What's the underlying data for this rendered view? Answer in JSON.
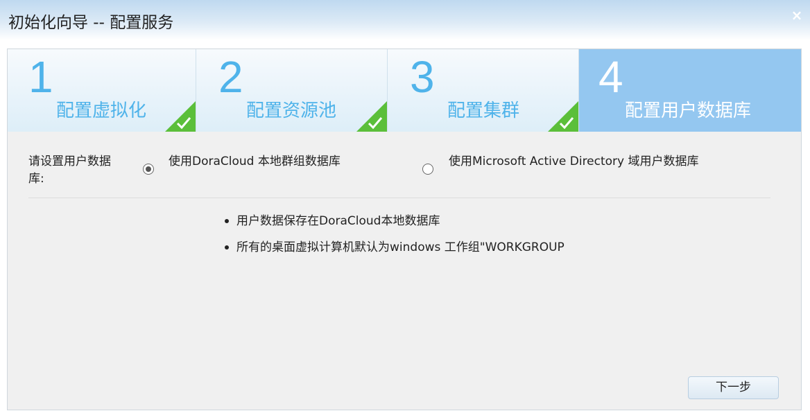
{
  "window": {
    "title": "初始化向导 -- 配置服务",
    "close_glyph": "×"
  },
  "steps": [
    {
      "number": "1",
      "label": "配置虚拟化",
      "state": "done"
    },
    {
      "number": "2",
      "label": "配置资源池",
      "state": "done"
    },
    {
      "number": "3",
      "label": "配置集群",
      "state": "done"
    },
    {
      "number": "4",
      "label": "配置用户数据库",
      "state": "active"
    }
  ],
  "form": {
    "prompt": "请设置用户数据库:",
    "options": [
      {
        "label": "使用DoraCloud 本地群组数据库",
        "selected": true
      },
      {
        "label": "使用Microsoft Active Directory 域用户数据库",
        "selected": false
      }
    ]
  },
  "notes": [
    "用户数据保存在DoraCloud本地数据库",
    "所有的桌面虚拟计算机默认为windows 工作组\"WORKGROUP"
  ],
  "footer": {
    "next_label": "下一步"
  },
  "colors": {
    "step_accent": "#4fb3ea",
    "step_active_bg": "#94c7f0",
    "check_green": "#5bbf3a"
  }
}
